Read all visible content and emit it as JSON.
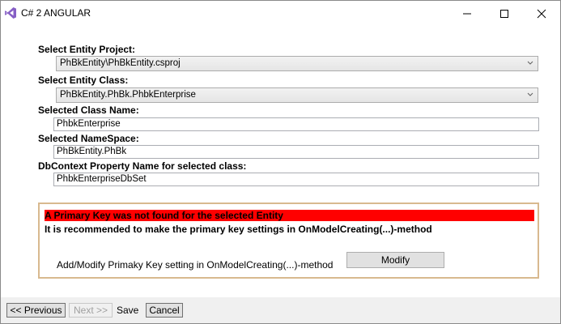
{
  "window": {
    "title": "C# 2 ANGULAR",
    "icon": "visual-studio-icon",
    "controls": [
      "minimize-icon",
      "maximize-icon",
      "close-icon"
    ]
  },
  "form": {
    "entity_project": {
      "label": "Select Entity Project:",
      "value": "PhBkEntity\\PhBkEntity.csproj"
    },
    "entity_class": {
      "label": "Select Entity Class:",
      "value": "PhBkEntity.PhBk.PhbkEnterprise"
    },
    "class_name": {
      "label": "Selected Class Name:",
      "value": "PhbkEnterprise"
    },
    "namespace": {
      "label": "Selected NameSpace:",
      "value": "PhBkEntity.PhBk"
    },
    "dbcontext_property": {
      "label": "DbContext Property Name for selected class:",
      "value": "PhbkEnterpriseDbSet"
    }
  },
  "warning_panel": {
    "alert": "A Primary Key was not found for the selected Entity",
    "recommendation": "It is recommended to make the primary key settings in OnModelCreating(...)-method",
    "setting_label": "Add/Modify Primaky Key setting in OnModelCreating(...)-method",
    "modify_button": "Modify"
  },
  "footer": {
    "previous": "<< Previous",
    "next": "Next >>",
    "save": "Save",
    "cancel": "Cancel"
  },
  "colors": {
    "alert_bg": "#ff0000",
    "panel_border": "#d8b98f",
    "footer_bg": "#f0f0f0",
    "disabled_text": "#a0a0a0"
  }
}
